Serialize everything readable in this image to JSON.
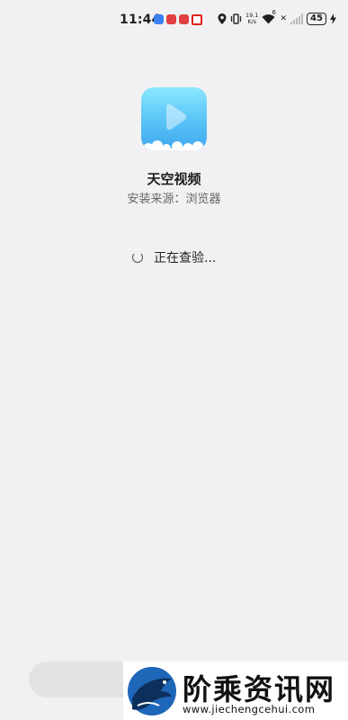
{
  "status_bar": {
    "time": "11:44",
    "net_speed_value": "19.1",
    "net_speed_unit": "K/s",
    "network_type": "6",
    "battery_level": "45",
    "notification_icons": [
      "blue-app-icon",
      "red-app-icon",
      "red-app-icon",
      "red-outline-app-icon"
    ],
    "colors": {
      "blue": "#3a7ff0",
      "red": "#e0403f"
    }
  },
  "app": {
    "name": "天空视频",
    "install_source": "安装来源：浏览器",
    "icon": "sky-video-play-icon"
  },
  "status": {
    "checking_text": "正在查验..."
  },
  "watermark": {
    "title": "阶乘资讯网",
    "url": "www.jiechengcehui.com",
    "logo": "eagle-logo-icon"
  }
}
